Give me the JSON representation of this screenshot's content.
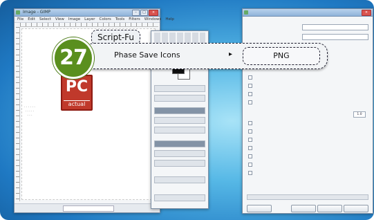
{
  "badge": {
    "number": "27"
  },
  "menu": {
    "tab_label": "Script-Fu",
    "item_label": "Phase Save Icons",
    "submenu_arrow": "▸",
    "submenu_item": "PNG"
  },
  "logo": {
    "line1": "PC",
    "line2": "actual"
  },
  "image_window": {
    "title": "Image - GIMP",
    "menus": [
      "File",
      "Edit",
      "Select",
      "View",
      "Image",
      "Layer",
      "Colors",
      "Tools",
      "Filters",
      "Windows",
      "Help"
    ]
  },
  "dialog": {
    "spin_value": "1.0"
  },
  "colors": {
    "badge": "#5a8f1e",
    "logo": "#c0392b",
    "desktop": "#1f79c3"
  }
}
